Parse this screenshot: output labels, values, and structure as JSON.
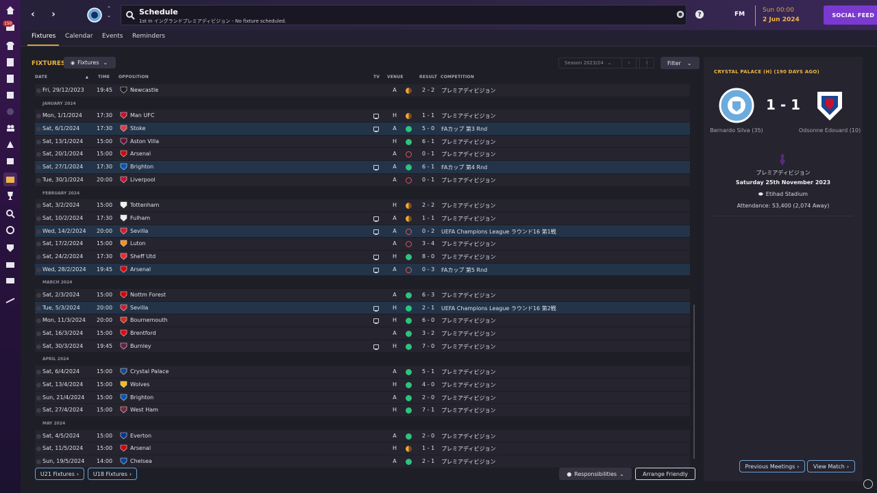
{
  "sidebar": {
    "badge": "150",
    "icons": [
      "home-icon",
      "inbox-icon",
      "squad-icon",
      "tactics-icon",
      "data-icon",
      "dynamics-icon",
      "medical-icon",
      "staff-icon",
      "training-icon",
      "development-icon",
      "schedule-icon",
      "competitions-icon",
      "scouting-icon",
      "transfers-icon",
      "club-vision-icon",
      "finances-icon",
      "dev-centre-icon",
      "report-icon"
    ]
  },
  "header": {
    "title": "Schedule",
    "subtitle": "1st in イングランドプレミアディビジョン - No fixture scheduled.",
    "fm_label": "FM",
    "time": "Sun 00:00",
    "date": "2 Jun 2024",
    "social_feed": "SOCIAL FEED"
  },
  "tabs": [
    "Fixtures",
    "Calendar",
    "Events",
    "Reminders"
  ],
  "fixtures": {
    "title": "FIXTURES",
    "view_dropdown": "Fixtures",
    "season": "Season 2023/24",
    "filter": "Filter",
    "columns": {
      "date": "DATE",
      "time": "TIME",
      "opposition": "OPPOSITION",
      "tv": "TV",
      "venue": "VENUE",
      "result": "RESULT",
      "competition": "COMPETITION"
    },
    "rows": [
      {
        "type": "fix",
        "date": "Fri, 29/12/2023",
        "time": "19:45",
        "opp": "Newcastle",
        "badge": "#1a1a1a",
        "tv": false,
        "venue": "A",
        "res": "D",
        "score": "2 - 2",
        "comp": "プレミアディビジョン",
        "hl": false
      },
      {
        "type": "mh",
        "label": "JANUARY 2024"
      },
      {
        "type": "fix",
        "date": "Mon, 1/1/2024",
        "time": "17:30",
        "opp": "Man UFC",
        "badge": "#c8102e",
        "tv": true,
        "venue": "H",
        "res": "D",
        "score": "1 - 1",
        "comp": "プレミアディビジョン",
        "hl": false
      },
      {
        "type": "fix",
        "date": "Sat, 6/1/2024",
        "time": "17:30",
        "opp": "Stoke",
        "badge": "#e03a3e",
        "tv": true,
        "venue": "A",
        "res": "W",
        "score": "5 - 0",
        "comp": "FAカップ 第3 Rnd",
        "hl": true
      },
      {
        "type": "fix",
        "date": "Sat, 13/1/2024",
        "time": "15:00",
        "opp": "Aston Villa",
        "badge": "#670e36",
        "tv": false,
        "venue": "H",
        "res": "W",
        "score": "6 - 1",
        "comp": "プレミアディビジョン",
        "hl": false
      },
      {
        "type": "fix",
        "date": "Sat, 20/1/2024",
        "time": "15:00",
        "opp": "Arsenal",
        "badge": "#db0007",
        "tv": false,
        "venue": "A",
        "res": "L",
        "score": "0 - 1",
        "comp": "プレミアディビジョン",
        "hl": false
      },
      {
        "type": "fix",
        "date": "Sat, 27/1/2024",
        "time": "17:30",
        "opp": "Brighton",
        "badge": "#0057b8",
        "tv": true,
        "venue": "A",
        "res": "W",
        "score": "6 - 1",
        "comp": "FAカップ 第4 Rnd",
        "hl": true
      },
      {
        "type": "fix",
        "date": "Tue, 30/1/2024",
        "time": "20:00",
        "opp": "Liverpool",
        "badge": "#c8102e",
        "tv": false,
        "venue": "A",
        "res": "L",
        "score": "0 - 1",
        "comp": "プレミアディビジョン",
        "hl": false
      },
      {
        "type": "mh",
        "label": "FEBRUARY 2024"
      },
      {
        "type": "fix",
        "date": "Sat, 3/2/2024",
        "time": "15:00",
        "opp": "Tottenham",
        "badge": "#f2f2f2",
        "tv": false,
        "venue": "H",
        "res": "D",
        "score": "2 - 2",
        "comp": "プレミアディビジョン",
        "hl": false
      },
      {
        "type": "fix",
        "date": "Sat, 10/2/2024",
        "time": "17:30",
        "opp": "Fulham",
        "badge": "#eeeeee",
        "tv": true,
        "venue": "A",
        "res": "D",
        "score": "1 - 1",
        "comp": "プレミアディビジョン",
        "hl": false
      },
      {
        "type": "fix",
        "date": "Wed, 14/2/2024",
        "time": "20:00",
        "opp": "Sevilla",
        "badge": "#d71a28",
        "tv": true,
        "venue": "A",
        "res": "L",
        "score": "0 - 2",
        "comp": "UEFA Champions League ラウンド16 第1戦",
        "hl": true
      },
      {
        "type": "fix",
        "date": "Sat, 17/2/2024",
        "time": "15:00",
        "opp": "Luton",
        "badge": "#f78f1e",
        "tv": false,
        "venue": "A",
        "res": "L",
        "score": "3 - 4",
        "comp": "プレミアディビジョン",
        "hl": false
      },
      {
        "type": "fix",
        "date": "Sat, 24/2/2024",
        "time": "17:30",
        "opp": "Sheff Utd",
        "badge": "#ee2737",
        "tv": true,
        "venue": "H",
        "res": "W",
        "score": "8 - 0",
        "comp": "プレミアディビジョン",
        "hl": false
      },
      {
        "type": "fix",
        "date": "Wed, 28/2/2024",
        "time": "19:45",
        "opp": "Arsenal",
        "badge": "#db0007",
        "tv": true,
        "venue": "A",
        "res": "L",
        "score": "0 - 3",
        "comp": "FAカップ 第5 Rnd",
        "hl": true
      },
      {
        "type": "mh",
        "label": "MARCH 2024"
      },
      {
        "type": "fix",
        "date": "Sat, 2/3/2024",
        "time": "15:00",
        "opp": "Nottm Forest",
        "badge": "#dd0000",
        "tv": false,
        "venue": "A",
        "res": "W",
        "score": "6 - 3",
        "comp": "プレミアディビジョン",
        "hl": false
      },
      {
        "type": "fix",
        "date": "Tue, 5/3/2024",
        "time": "20:00",
        "opp": "Sevilla",
        "badge": "#d71a28",
        "tv": true,
        "venue": "H",
        "res": "W",
        "score": "2 - 1",
        "comp": "UEFA Champions League ラウンド16 第2戦",
        "hl": true
      },
      {
        "type": "fix",
        "date": "Mon, 11/3/2024",
        "time": "20:00",
        "opp": "Bournemouth",
        "badge": "#da291c",
        "tv": true,
        "venue": "H",
        "res": "W",
        "score": "6 - 0",
        "comp": "プレミアディビジョン",
        "hl": false
      },
      {
        "type": "fix",
        "date": "Sat, 16/3/2024",
        "time": "15:00",
        "opp": "Brentford",
        "badge": "#e30613",
        "tv": false,
        "venue": "A",
        "res": "W",
        "score": "3 - 2",
        "comp": "プレミアディビジョン",
        "hl": false
      },
      {
        "type": "fix",
        "date": "Sat, 30/3/2024",
        "time": "19:45",
        "opp": "Burnley",
        "badge": "#6c1d45",
        "tv": true,
        "venue": "H",
        "res": "W",
        "score": "7 - 0",
        "comp": "プレミアディビジョン",
        "hl": false
      },
      {
        "type": "mh",
        "label": "APRIL 2024"
      },
      {
        "type": "fix",
        "date": "Sat, 6/4/2024",
        "time": "15:00",
        "opp": "Crystal Palace",
        "badge": "#1b458f",
        "tv": false,
        "venue": "A",
        "res": "W",
        "score": "5 - 1",
        "comp": "プレミアディビジョン",
        "hl": false
      },
      {
        "type": "fix",
        "date": "Sat, 13/4/2024",
        "time": "15:00",
        "opp": "Wolves",
        "badge": "#fdb913",
        "tv": false,
        "venue": "H",
        "res": "W",
        "score": "4 - 0",
        "comp": "プレミアディビジョン",
        "hl": false
      },
      {
        "type": "fix",
        "date": "Sun, 21/4/2024",
        "time": "15:00",
        "opp": "Brighton",
        "badge": "#0057b8",
        "tv": false,
        "venue": "A",
        "res": "W",
        "score": "2 - 0",
        "comp": "プレミアディビジョン",
        "hl": false
      },
      {
        "type": "fix",
        "date": "Sat, 27/4/2024",
        "time": "15:00",
        "opp": "West Ham",
        "badge": "#7a263a",
        "tv": false,
        "venue": "H",
        "res": "W",
        "score": "7 - 1",
        "comp": "プレミアディビジョン",
        "hl": false
      },
      {
        "type": "mh",
        "label": "MAY 2024"
      },
      {
        "type": "fix",
        "date": "Sat, 4/5/2024",
        "time": "15:00",
        "opp": "Everton",
        "badge": "#003399",
        "tv": false,
        "venue": "A",
        "res": "W",
        "score": "2 - 0",
        "comp": "プレミアディビジョン",
        "hl": false
      },
      {
        "type": "fix",
        "date": "Sat, 11/5/2024",
        "time": "15:00",
        "opp": "Arsenal",
        "badge": "#db0007",
        "tv": false,
        "venue": "H",
        "res": "D",
        "score": "1 - 1",
        "comp": "プレミアディビジョン",
        "hl": false
      },
      {
        "type": "fix",
        "date": "Sun, 19/5/2024",
        "time": "14:00",
        "opp": "Chelsea",
        "badge": "#034694",
        "tv": false,
        "venue": "A",
        "res": "W",
        "score": "2 - 1",
        "comp": "プレミアディビジョン",
        "hl": false
      }
    ],
    "u21": "U21 Fixtures",
    "u18": "U18 Fixtures",
    "responsibilities": "Responsibilities",
    "arrange_friendly": "Arrange Friendly"
  },
  "match_panel": {
    "title": "CRYSTAL PALACE (H) (190 DAYS AGO)",
    "score": "1 - 1",
    "home_scorer": "Bernardo Silva (35)",
    "away_scorer": "Odsonne Edouard (10)",
    "competition": "プレミアディビジョン",
    "date": "Saturday 25th November 2023",
    "stadium": "Etihad Stadium",
    "attendance": "Attendance: 53,400 (2,074 Away)",
    "previous_meetings": "Previous Meetings",
    "view_match": "View Match"
  },
  "colors": {
    "accent": "#f0b544",
    "win": "#2ec27e",
    "loss": "#e05a5a",
    "draw": "#f0a63c",
    "social": "#7a3ad0",
    "highlight_row": "#233449"
  }
}
